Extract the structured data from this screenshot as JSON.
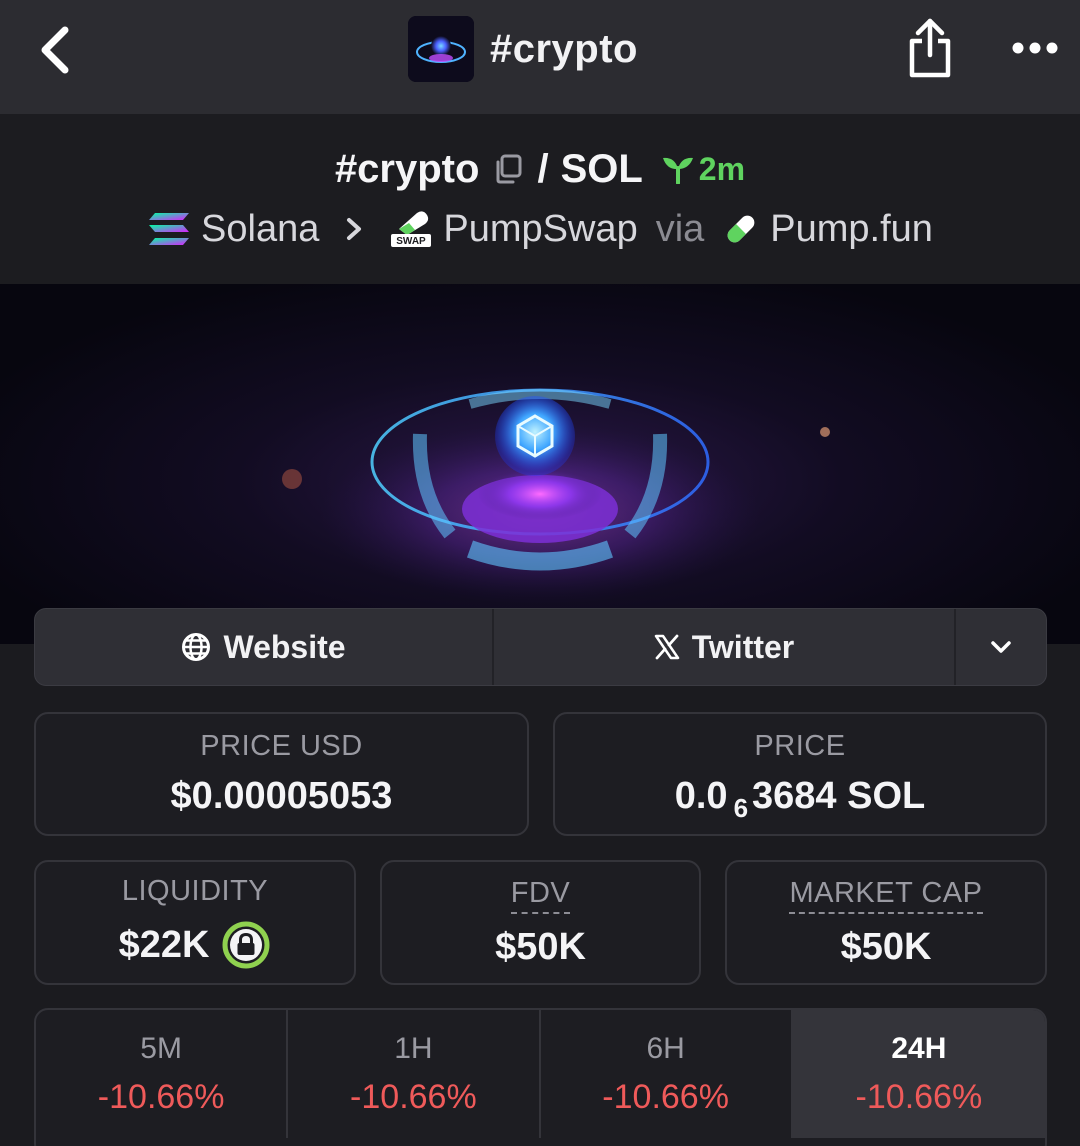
{
  "topbar": {
    "title": "#crypto"
  },
  "pair": {
    "base": "#crypto",
    "separator": "/",
    "quote": "SOL",
    "age": "2m"
  },
  "chain": {
    "network": "Solana",
    "dex": "PumpSwap",
    "via": "via",
    "launchpad": "Pump.fun",
    "swap_badge": "SWAP"
  },
  "links": {
    "website": "Website",
    "twitter": "Twitter"
  },
  "stats": {
    "price_usd_label": "PRICE USD",
    "price_usd_value": "$0.00005053",
    "price_label": "PRICE",
    "price_prefix": "0.0",
    "price_zero_count": "6",
    "price_suffix": "3684 SOL",
    "liquidity_label": "LIQUIDITY",
    "liquidity_value": "$22K",
    "fdv_label": "FDV",
    "fdv_value": "$50K",
    "mcap_label": "MARKET CAP",
    "mcap_value": "$50K"
  },
  "timeframes": [
    {
      "label": "5M",
      "value": "-10.66%"
    },
    {
      "label": "1H",
      "value": "-10.66%"
    },
    {
      "label": "6H",
      "value": "-10.66%"
    },
    {
      "label": "24H",
      "value": "-10.66%"
    }
  ],
  "colors": {
    "negative": "#ef5a5a",
    "positive": "#5fd35f",
    "lock": "#8fd14f"
  }
}
